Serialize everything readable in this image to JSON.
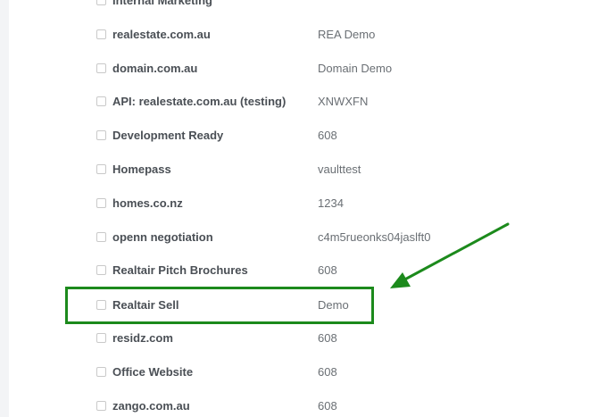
{
  "integrations": [
    {
      "name": "Internal Marketing",
      "value": ""
    },
    {
      "name": "realestate.com.au",
      "value": "REA Demo"
    },
    {
      "name": "domain.com.au",
      "value": "Domain Demo"
    },
    {
      "name": "API: realestate.com.au (testing)",
      "value": "XNWXFN"
    },
    {
      "name": "Development Ready",
      "value": "608"
    },
    {
      "name": "Homepass",
      "value": "vaulttest"
    },
    {
      "name": "homes.co.nz",
      "value": "1234"
    },
    {
      "name": "openn negotiation",
      "value": "c4m5rueonks04jaslft0"
    },
    {
      "name": "Realtair Pitch Brochures",
      "value": "608"
    },
    {
      "name": "Realtair Sell",
      "value": "Demo"
    },
    {
      "name": "residz.com",
      "value": "608"
    },
    {
      "name": "Office Website",
      "value": "608"
    },
    {
      "name": "zango.com.au",
      "value": "608"
    }
  ],
  "annotation": {
    "highlight_color": "#1c8a1c",
    "highlighted_row": "Realtair Sell"
  }
}
